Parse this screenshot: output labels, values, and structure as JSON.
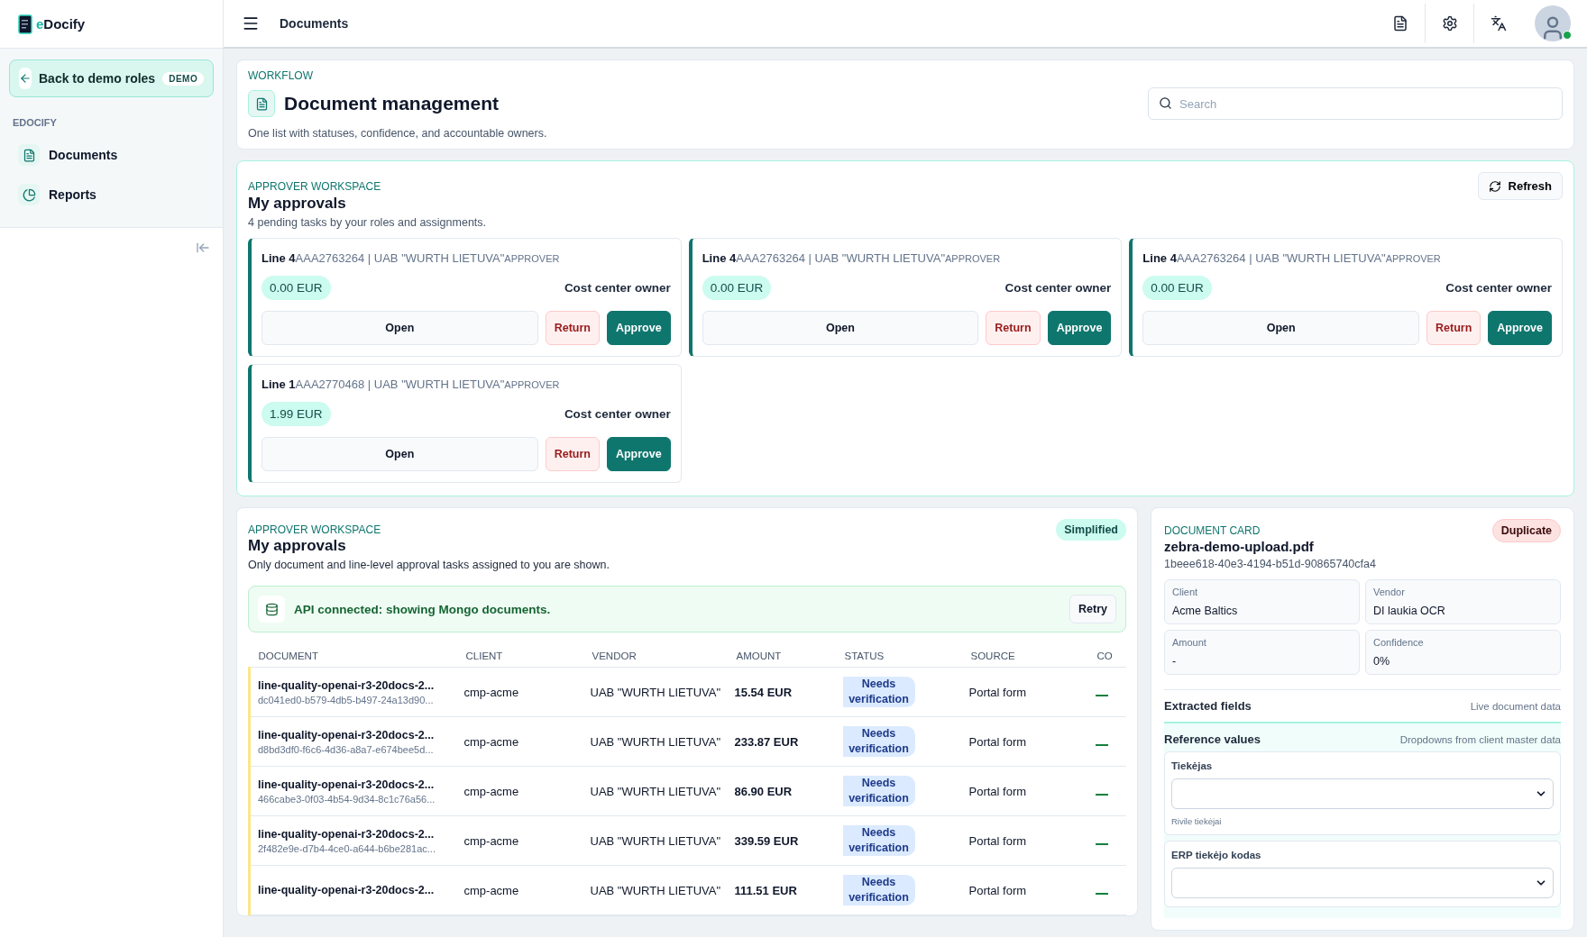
{
  "brand": {
    "prefix": "e",
    "name": "Docify"
  },
  "header": {
    "title": "Documents"
  },
  "sidebar": {
    "back_button": {
      "label": "Back to demo roles",
      "badge": "DEMO"
    },
    "section_label": "EDOCIFY",
    "items": [
      {
        "label": "Documents",
        "kind": "document"
      },
      {
        "label": "Reports",
        "kind": "chart"
      }
    ]
  },
  "workflow": {
    "eyebrow": "WORKFLOW",
    "title": "Document management",
    "subtitle": "One list with statuses, confidence, and accountable owners.",
    "search": {
      "placeholder": "Search"
    }
  },
  "approvals": {
    "eyebrow": "APPROVER WORKSPACE",
    "title": "My approvals",
    "subtitle": "4 pending tasks by your roles and assignments.",
    "refresh": "Refresh",
    "tasks": [
      {
        "line": "Line 4",
        "ref": "AAA2763264 | UAB \"WURTH LIETUVA\"",
        "role": "APPROVER",
        "amount": "0.00 EUR",
        "owner": "Cost center owner",
        "buttons": [
          "Open",
          "Return",
          "Approve"
        ]
      },
      {
        "line": "Line 4",
        "ref": "AAA2763264 | UAB \"WURTH LIETUVA\"",
        "role": "APPROVER",
        "amount": "0.00 EUR",
        "owner": "Cost center owner",
        "buttons": [
          "Open",
          "Return",
          "Approve"
        ]
      },
      {
        "line": "Line 4",
        "ref": "AAA2763264 | UAB \"WURTH LIETUVA\"",
        "role": "APPROVER",
        "amount": "0.00 EUR",
        "owner": "Cost center owner",
        "buttons": [
          "Open",
          "Return",
          "Approve"
        ]
      },
      {
        "line": "Line 1",
        "ref": "AAA2770468 | UAB \"WURTH LIETUVA\"",
        "role": "APPROVER",
        "amount": "1.99 EUR",
        "owner": "Cost center owner",
        "buttons": [
          "Open",
          "Return",
          "Approve"
        ]
      }
    ]
  },
  "list": {
    "eyebrow": "APPROVER WORKSPACE",
    "title": "My approvals",
    "subtitle": "Only document and line-level approval tasks assigned to you are shown.",
    "mode_badge": "Simplified",
    "api_notice": {
      "text": "API connected: showing Mongo documents.",
      "button": "Retry"
    },
    "table": {
      "columns": [
        "DOCUMENT",
        "CLIENT",
        "VENDOR",
        "AMOUNT",
        "STATUS",
        "SOURCE",
        "CO"
      ],
      "rows": [
        {
          "name": "line-quality-openai-r3-20docs-2...",
          "id": "dc041ed0-b579-4db5-b497-24a13d90...",
          "client": "cmp-acme",
          "vendor": "UAB \"WURTH LIETUVA\"",
          "amount": "15.54 EUR",
          "status": "Needs verification",
          "source": "Portal form"
        },
        {
          "name": "line-quality-openai-r3-20docs-2...",
          "id": "d8bd3df0-f6c6-4d36-a8a7-e674bee5d...",
          "client": "cmp-acme",
          "vendor": "UAB \"WURTH LIETUVA\"",
          "amount": "233.87 EUR",
          "status": "Needs verification",
          "source": "Portal form"
        },
        {
          "name": "line-quality-openai-r3-20docs-2...",
          "id": "466cabe3-0f03-4b54-9d34-8c1c76a56...",
          "client": "cmp-acme",
          "vendor": "UAB \"WURTH LIETUVA\"",
          "amount": "86.90 EUR",
          "status": "Needs verification",
          "source": "Portal form"
        },
        {
          "name": "line-quality-openai-r3-20docs-2...",
          "id": "2f482e9e-d7b4-4ce0-a644-b6be281ac...",
          "client": "cmp-acme",
          "vendor": "UAB \"WURTH LIETUVA\"",
          "amount": "339.59 EUR",
          "status": "Needs verification",
          "source": "Portal form"
        },
        {
          "name": "line-quality-openai-r3-20docs-2...",
          "client": "cmp-acme",
          "vendor": "UAB \"WURTH LIETUVA\"",
          "amount": "111.51 EUR",
          "status": "Needs verification",
          "source": "Portal form"
        }
      ]
    }
  },
  "document_card": {
    "eyebrow": "DOCUMENT CARD",
    "badge": "Duplicate",
    "filename": "zebra-demo-upload.pdf",
    "id": "1beee618-40e3-4194-b51d-90865740cfa4",
    "facts": [
      {
        "label": "Client",
        "value": "Acme Baltics"
      },
      {
        "label": "Vendor",
        "value": "DI laukia OCR"
      },
      {
        "label": "Amount",
        "value": "-"
      },
      {
        "label": "Confidence",
        "value": "0%"
      }
    ],
    "extracted": {
      "title": "Extracted fields",
      "note": "Live document data"
    },
    "reference": {
      "title": "Reference values",
      "note": "Dropdowns from client master data",
      "fields": [
        {
          "label": "Tiekėjas",
          "hint": "Rivile tiekėjai"
        },
        {
          "label": "ERP tiekėjo kodas"
        }
      ]
    }
  }
}
